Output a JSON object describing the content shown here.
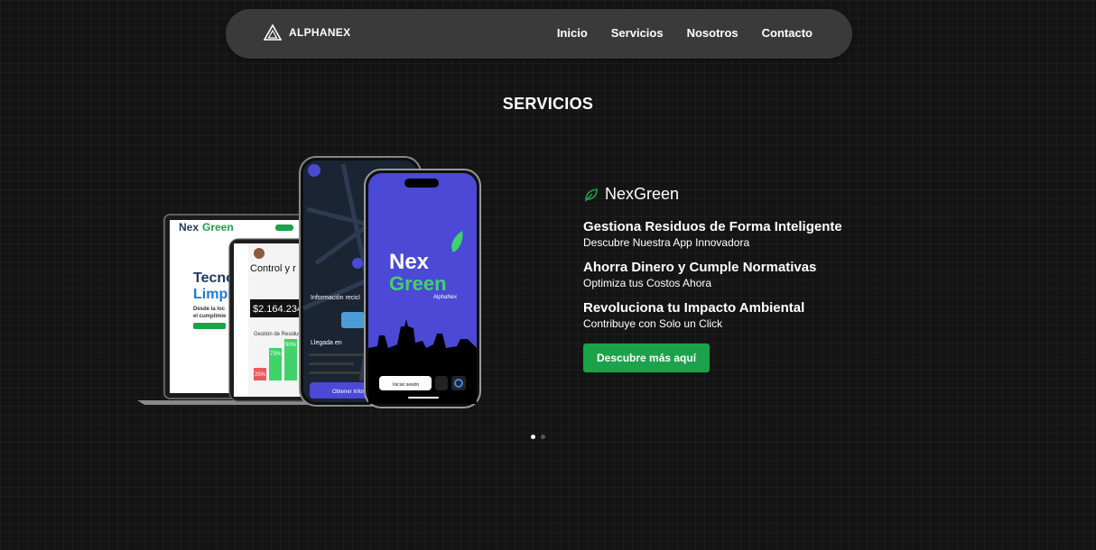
{
  "nav": {
    "brand": "ALPHANEX",
    "links": [
      "Inicio",
      "Servicios",
      "Nosotros",
      "Contacto"
    ]
  },
  "section": {
    "title": "SERVICIOS"
  },
  "product": {
    "name": "NexGreen",
    "features": [
      {
        "title": "Gestiona Residuos de Forma Inteligente",
        "subtitle": "Descubre Nuestra App Innovadora"
      },
      {
        "title": "Ahorra Dinero y Cumple Normativas",
        "subtitle": "Optimiza tus Costos Ahora"
      },
      {
        "title": "Revoluciona tu Impacto Ambiental",
        "subtitle": "Contribuye con Solo un Click"
      }
    ],
    "cta_label": "Descubre más aquí"
  },
  "mockup": {
    "laptop_logo_a": "Nex",
    "laptop_logo_b": "Green",
    "laptop_heading_a": "Tecno",
    "laptop_heading_b": "Limpi",
    "laptop_sub_a": "Desde la loc",
    "laptop_sub_b": "el cumplimie",
    "tablet_title": "Control y r",
    "tablet_amount": "$2.164.234",
    "tablet_section": "Gestión de Residuos",
    "tablet_pct_1": "25%",
    "tablet_pct_2": "73%",
    "tablet_pct_3": "90%",
    "phone1_info": "Información recicl",
    "phone1_eta": "Llegada en",
    "phone1_button": "Obtener Infor",
    "phone2_logo_a": "Nex",
    "phone2_logo_b": "Green",
    "phone2_logo_c": "AlphaNex",
    "phone2_login": "Iniciar sesión"
  },
  "carousel": {
    "active_index": 0,
    "count": 2
  },
  "colors": {
    "accent_green": "#1aa34a",
    "phone_purple": "#4b49d6",
    "navbar_bg": "#3a3a3a",
    "page_bg": "#141414"
  },
  "icons": {
    "brand": "alphanex-logo-icon",
    "product": "leaf-icon"
  }
}
